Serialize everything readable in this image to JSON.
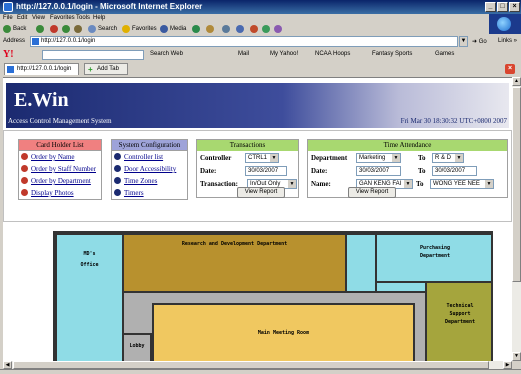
{
  "window": {
    "title": "http://127.0.0.1/login - Microsoft Internet Explorer"
  },
  "menu": [
    "File",
    "Edit",
    "View",
    "Favorites",
    "Tools",
    "Help"
  ],
  "toolbar": {
    "back": "Back",
    "search": "Search",
    "favorites": "Favorites",
    "media": "Media"
  },
  "address": {
    "label": "Address",
    "url": "http://127.0.0.1/login",
    "go": "Go",
    "links": "Links"
  },
  "yahoo": {
    "search_web": "Search Web",
    "mail": "Mail",
    "my_yahoo": "My Yahoo!",
    "ncaa": "NCAA Hoops",
    "fantasy": "Fantasy Sports",
    "games": "Games"
  },
  "tabs": {
    "active": "http://127.0.0.1/login",
    "add": "Add Tab"
  },
  "page": {
    "logo": "E.Win",
    "subtitle": "Access Control Management System",
    "clock": "Fri Mar 30 18:30:32 UTC+0800 2007",
    "card_holder": {
      "title": "Card Holder List",
      "items": [
        "Order by Name",
        "Order by Staff Number",
        "Order by Department",
        "Display Photos"
      ]
    },
    "sys_config": {
      "title": "System Configuration",
      "items": [
        "Controller list",
        "Door Accessibility",
        "Time Zones",
        "Timers"
      ]
    },
    "transactions": {
      "title": "Transactions",
      "controller_label": "Controller",
      "controller_value": "CTRL1",
      "date_label": "Date:",
      "date_value": "30/03/2007",
      "transaction_label": "Transaction:",
      "transaction_value": "In/Out Only",
      "view_report": "View Report"
    },
    "attendance": {
      "title": "Time Attendance",
      "department_label": "Department",
      "department_value": "Marketing",
      "to_label": "To",
      "to_department_value": "R & D",
      "date_label": "Date:",
      "date_from": "30/03/2007",
      "date_to": "30/03/2007",
      "name_label": "Name:",
      "name_from": "GAN KENG FAI",
      "name_to": "WONG YEE NEE",
      "view_report": "View Report"
    },
    "floorplan": {
      "rd": "Research and Development Department",
      "purchasing": [
        "Purchasing",
        "Department"
      ],
      "md": [
        "MD's",
        "Office"
      ],
      "technical": [
        "Technical",
        "Support",
        "Department"
      ],
      "lobby": "Lobby",
      "meeting": "Main Meeting Room"
    }
  },
  "colors": {
    "titlebar": "#0a246a",
    "card_holder_header": "#f08080",
    "sys_config_header": "#9ea3d9",
    "transactions_header": "#a8d870",
    "attendance_header": "#a8d870",
    "floor_cyan": "#8fdce6",
    "floor_olive": "#b8912e",
    "floor_yellow": "#f0c860"
  }
}
